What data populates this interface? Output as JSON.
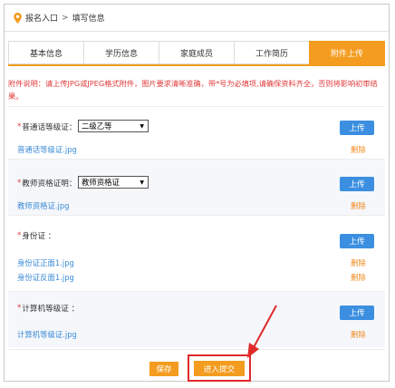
{
  "breadcrumb": {
    "home": "报名入口",
    "separator": ">",
    "current": "填写信息"
  },
  "tabs": [
    {
      "label": "基本信息",
      "active": false
    },
    {
      "label": "学历信息",
      "active": false
    },
    {
      "label": "家庭成员",
      "active": false
    },
    {
      "label": "工作简历",
      "active": false
    },
    {
      "label": "附件上传",
      "active": true
    }
  ],
  "notice": "附件说明：请上传JPG或JPEG格式附件，图片要求清晰准确，带*号为必填项,请确保资料齐全，否则将影响初审结果。",
  "sections": {
    "putonghua": {
      "required": "*",
      "label": "普通话等级证：",
      "select_value": "二级乙等",
      "upload_label": "上传",
      "files": [
        {
          "name": "普通话等级证.jpg",
          "delete_label": "删除"
        }
      ]
    },
    "teacher": {
      "required": "*",
      "label": "教师资格证明：",
      "select_value": "教师资格证",
      "upload_label": "上传",
      "files": [
        {
          "name": "教师资格证.jpg",
          "delete_label": "删除"
        }
      ]
    },
    "idcard": {
      "required": "*",
      "label": "身份证 ：",
      "upload_label": "上传",
      "files": [
        {
          "name": "身份证正面1.jpg",
          "delete_label": "删除"
        },
        {
          "name": "身份证反面1.jpg",
          "delete_label": "删除"
        }
      ]
    },
    "computer": {
      "required": "*",
      "label": "计算机等级证 ：",
      "upload_label": "上传",
      "files": [
        {
          "name": "计算机等级证.jpg",
          "delete_label": "删除"
        }
      ]
    }
  },
  "actions": {
    "save_label": "保存",
    "submit_label": "进入提交"
  },
  "colors": {
    "accent": "#f39c1f",
    "upload_blue": "#3c8fe0",
    "link_blue": "#3b8bd6",
    "required_red": "#e03a3a",
    "annotation_red": "#e02a2a"
  },
  "icons": {
    "breadcrumb": "location-pin-icon",
    "select": "caret-down-icon"
  }
}
